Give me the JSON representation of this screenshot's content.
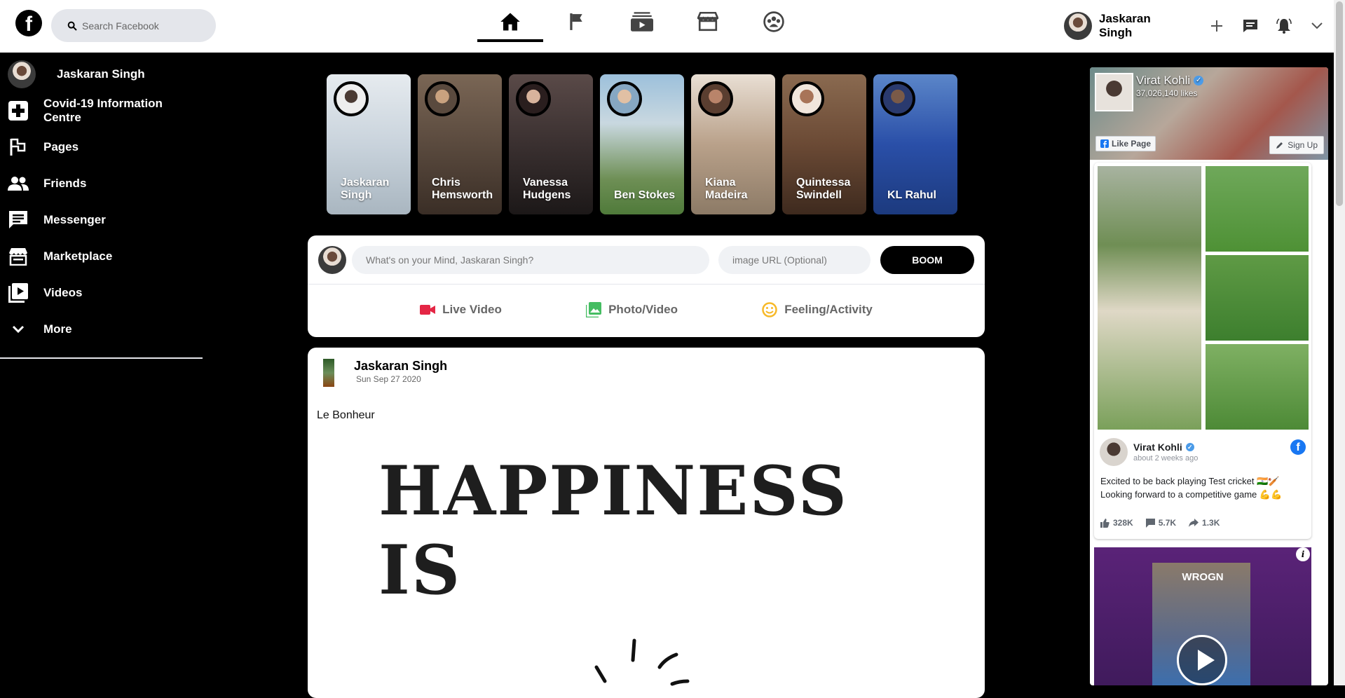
{
  "header": {
    "logo": "f",
    "search_placeholder": "Search Facebook",
    "nav": [
      {
        "icon": "home-icon",
        "active": true
      },
      {
        "icon": "flag-icon",
        "active": false
      },
      {
        "icon": "watch-icon",
        "active": false
      },
      {
        "icon": "marketplace-icon",
        "active": false
      },
      {
        "icon": "groups-icon",
        "active": false
      }
    ],
    "user_name": "Jaskaran Singh",
    "right_icons": [
      "plus-icon",
      "messenger-icon",
      "notifications-icon",
      "chevron-down-icon"
    ]
  },
  "sidebar": {
    "items": [
      {
        "label": "Jaskaran Singh",
        "icon": "profile-avatar"
      },
      {
        "label": "Covid-19 Information Centre",
        "icon": "medical-cross-icon"
      },
      {
        "label": "Pages",
        "icon": "flag-icon"
      },
      {
        "label": "Friends",
        "icon": "people-icon"
      },
      {
        "label": "Messenger",
        "icon": "chat-icon"
      },
      {
        "label": "Marketplace",
        "icon": "store-icon"
      },
      {
        "label": "Videos",
        "icon": "video-library-icon"
      },
      {
        "label": "More",
        "icon": "chevron-down-icon"
      }
    ]
  },
  "stories": [
    {
      "name": "Jaskaran Singh",
      "color": "#c9d3dc"
    },
    {
      "name": "Chris Hemsworth",
      "color": "#5a4a3e"
    },
    {
      "name": "Vanessa Hudgens",
      "color": "#3a3030"
    },
    {
      "name": "Ben Stokes",
      "color": "#6e8f55"
    },
    {
      "name": "Kiana Madeira",
      "color": "#b9a18a"
    },
    {
      "name": "Quintessa Swindell",
      "color": "#6b4a35"
    },
    {
      "name": "KL Rahul",
      "color": "#2a4fa8"
    }
  ],
  "composer": {
    "status_placeholder": "What's on your Mind, Jaskaran Singh?",
    "image_placeholder": "image URL (Optional)",
    "submit_label": "BOOM",
    "options": [
      {
        "label": "Live Video",
        "icon": "video-camera-icon",
        "color": "#e42645"
      },
      {
        "label": "Photo/Video",
        "icon": "photo-icon",
        "color": "#45bd62"
      },
      {
        "label": "Feeling/Activity",
        "icon": "smiley-icon",
        "color": "#f7b928"
      }
    ]
  },
  "post": {
    "author": "Jaskaran Singh",
    "date": "Sun Sep 27 2020",
    "text": "Le Bonheur",
    "image_text": "HAPPINESS IS"
  },
  "page_plugin": {
    "page_name": "Virat Kohli",
    "likes": "37,026,140 likes",
    "like_button": "Like Page",
    "signup_button": "Sign Up",
    "post_author": "Virat Kohli",
    "post_time": "about 2 weeks ago",
    "post_text": "Excited to be back playing Test cricket 🇮🇳🏏 Looking forward to a competitive game 💪💪",
    "reactions": "328K",
    "comments": "5.7K",
    "shares": "1.3K",
    "video_brand": "WROGN",
    "info_label": "i"
  }
}
